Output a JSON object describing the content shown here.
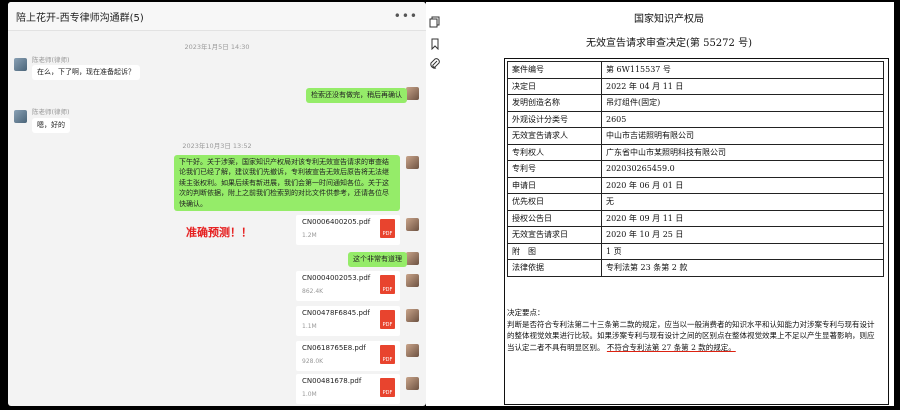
{
  "chat": {
    "title": "陪上花开-西专律师沟通群(5)",
    "menu_icon": "more-dots-icon",
    "timestamps": [
      "2023年1月5日 14:30",
      "2023年10月3日 13:52"
    ],
    "messages": [
      {
        "from": "in",
        "name": "陈老师(律师)",
        "text": "在么，下了啊，现在准备起诉？"
      },
      {
        "from": "out",
        "text": "检索还没有做完，稍后再确认"
      },
      {
        "from": "in",
        "name": "陈老师(律师)",
        "text": "嗯，好的"
      },
      {
        "from": "out",
        "text": "下午好。关于涉案，国家知识产权局对该专利无效宣告请求的审查结论我们已经了解，建议我们先撤诉，专利被宣告无效后原告将无法继续主张权利。如果后续有新进展，我们会第一时间通知各位。关于这次的判断依据，附上之前我们检索到的对比文件供参考，还请各位尽快确认。"
      }
    ],
    "files": [
      {
        "name": "CN0006400205.pdf",
        "size": "1.2M",
        "type": "PDF"
      },
      {
        "name": "CN0004002053.pdf",
        "size": "862.4K",
        "type": "PDF"
      },
      {
        "name": "CN00478F6845.pdf",
        "size": "1.1M",
        "type": "PDF"
      },
      {
        "name": "CN0618765E8.pdf",
        "size": "928.0K",
        "type": "PDF"
      },
      {
        "name": "CN00481678.pdf",
        "size": "1.0M",
        "type": "PDF"
      }
    ],
    "short_reply": "这个非常有道理",
    "prediction": "准确预测！！"
  },
  "toolbar": {
    "icons": [
      "copy-icon",
      "bookmark-icon",
      "attachment-icon"
    ]
  },
  "document": {
    "agency": "国家知识产权局",
    "title": "无效宣告请求审查决定(第 55272 号)",
    "rows": [
      {
        "k": "案件编号",
        "v": "第 6W115537 号"
      },
      {
        "k": "决定日",
        "v": "2022 年 04 月 11 日"
      },
      {
        "k": "发明创造名称",
        "v": "吊灯组件(固定)"
      },
      {
        "k": "外观设计分类号",
        "v": "2605"
      },
      {
        "k": "无效宣告请求人",
        "v": "中山市吉诺照明有限公司"
      },
      {
        "k": "专利权人",
        "v": "广东省中山市某照明科技有限公司"
      },
      {
        "k": "专利号",
        "v": "202030265459.0"
      },
      {
        "k": "申请日",
        "v": "2020 年 06 月 01 日"
      },
      {
        "k": "优先权日",
        "v": "无"
      },
      {
        "k": "授权公告日",
        "v": "2020 年 09 月 11 日"
      },
      {
        "k": "无效宣告请求日",
        "v": "2020 年 10 月 25 日"
      },
      {
        "k": "附　图",
        "v": "1 页"
      },
      {
        "k": "法律依据",
        "v": "专利法第 23 条第 2 款"
      }
    ],
    "summary_label": "决定要点：",
    "summary_text": "判断是否符合专利法第二十三条第二款的规定，应当以一般消费者的知识水平和认知能力对涉案专利与现有设计的整体视觉效果进行比较。如果涉案专利与现有设计之间的区别点在整体视觉效果上不足以产生显著影响，则应当认定二者不具有明显区别。",
    "summary_underlined": "不符合专利法第 27 条第 2 款的规定。"
  }
}
